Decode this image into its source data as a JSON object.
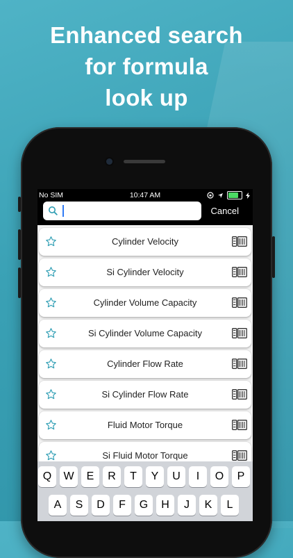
{
  "headline": {
    "line1": "Enhanced search",
    "line2": "for formula",
    "line3": "look up"
  },
  "status_bar": {
    "carrier": "No SIM",
    "time": "10:47 AM",
    "battery_level": 0.8,
    "battery_color": "#4cd964"
  },
  "search": {
    "value": "",
    "placeholder": "",
    "cancel_label": "Cancel"
  },
  "list": {
    "items": [
      {
        "label": "Cylinder Velocity"
      },
      {
        "label": "Si Cylinder Velocity"
      },
      {
        "label": "Cylinder Volume Capacity"
      },
      {
        "label": "Si Cylinder Volume Capacity"
      },
      {
        "label": "Cylinder Flow Rate"
      },
      {
        "label": "Si Cylinder Flow Rate"
      },
      {
        "label": "Fluid Motor Torque"
      },
      {
        "label": "Si Fluid Motor Torque"
      }
    ]
  },
  "keyboard": {
    "row1": [
      "Q",
      "W",
      "E",
      "R",
      "T",
      "Y",
      "U",
      "I",
      "O",
      "P"
    ],
    "row2": [
      "A",
      "S",
      "D",
      "F",
      "G",
      "H",
      "J",
      "K",
      "L"
    ]
  },
  "icons": {
    "favorite": "star-icon",
    "calculator": "calculator-icon",
    "search": "search-icon"
  },
  "colors": {
    "accent": "#3aa1b5",
    "star": "#2d9db3",
    "caret": "#2f7bf5"
  }
}
